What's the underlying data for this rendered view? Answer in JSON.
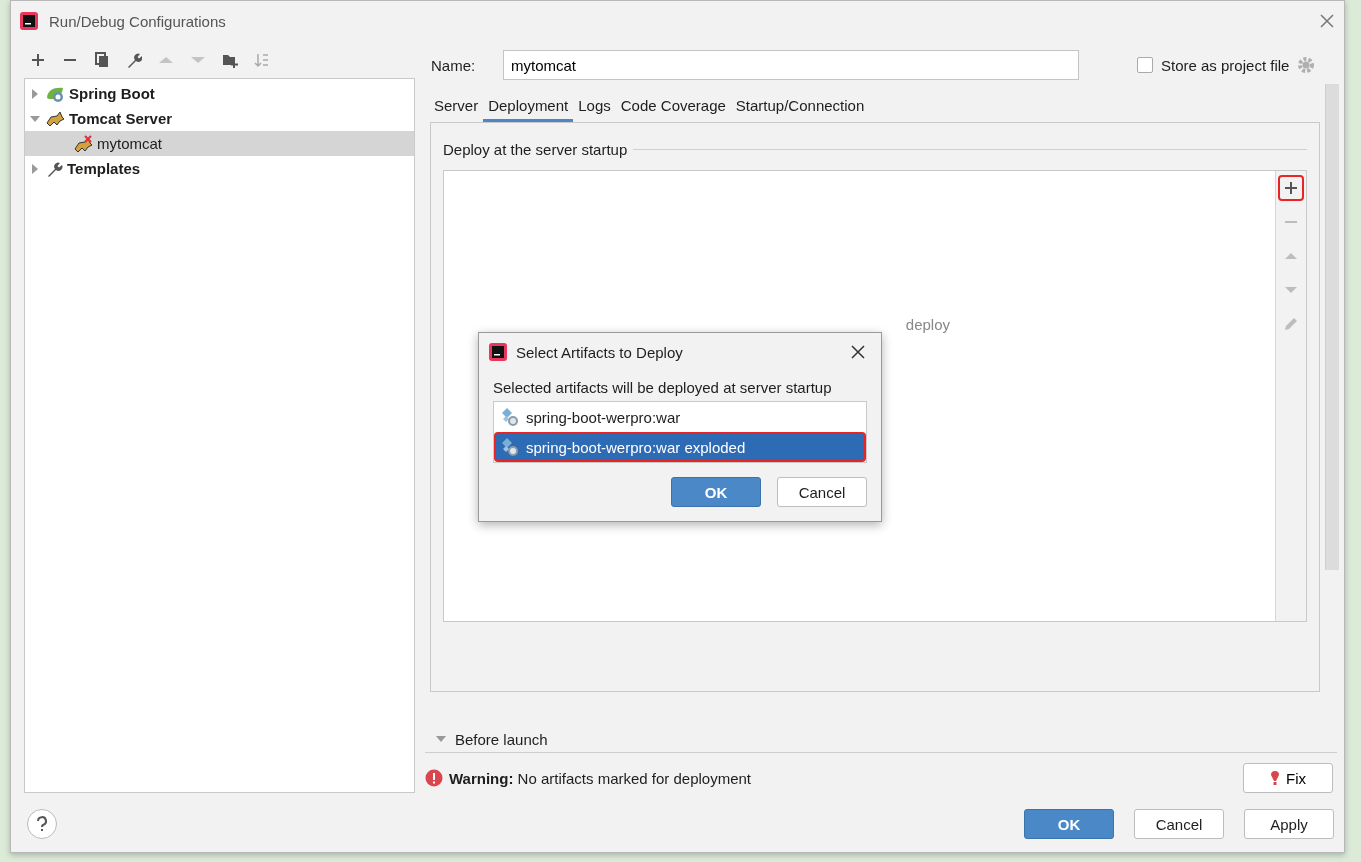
{
  "window": {
    "title": "Run/Debug Configurations"
  },
  "tree": [
    {
      "label": "Spring Boot",
      "kind": "spring",
      "expanded": false,
      "selected": false
    },
    {
      "label": "Tomcat Server",
      "kind": "tomcat",
      "expanded": true,
      "selected": false,
      "children": [
        {
          "label": "mytomcat",
          "kind": "tomcat-error",
          "selected": true
        }
      ]
    },
    {
      "label": "Templates",
      "kind": "wrench",
      "expanded": false,
      "selected": false
    }
  ],
  "name_field": {
    "label": "Name:",
    "value": "mytomcat"
  },
  "store_as_project_file": {
    "label": "Store as project file",
    "checked": false
  },
  "tabs": [
    {
      "label": "Server",
      "selected": false
    },
    {
      "label": "Deployment",
      "selected": true
    },
    {
      "label": "Logs",
      "selected": false
    },
    {
      "label": "Code Coverage",
      "selected": false
    },
    {
      "label": "Startup/Connection",
      "selected": false
    }
  ],
  "deploy_section": {
    "title": "Deploy at the server startup",
    "empty_text": "deploy",
    "side_buttons": [
      {
        "kind": "add",
        "disabled": false,
        "highlighted": true
      },
      {
        "kind": "remove",
        "disabled": true,
        "highlighted": false
      },
      {
        "kind": "up",
        "disabled": true,
        "highlighted": false
      },
      {
        "kind": "down",
        "disabled": true,
        "highlighted": false
      },
      {
        "kind": "edit",
        "disabled": true,
        "highlighted": false
      }
    ]
  },
  "popup": {
    "title": "Select Artifacts to Deploy",
    "description": "Selected artifacts will be deployed at server startup",
    "artifacts": [
      {
        "label": "spring-boot-werpro:war",
        "selected": false,
        "highlighted": false
      },
      {
        "label": "spring-boot-werpro:war exploded",
        "selected": true,
        "highlighted": true
      }
    ],
    "buttons": [
      {
        "label": "OK",
        "kind": "primary"
      },
      {
        "label": "Cancel",
        "kind": "normal"
      }
    ]
  },
  "before_launch": {
    "label": "Before launch",
    "expanded": true
  },
  "warning": {
    "label": "Warning:",
    "message": "No artifacts marked for deployment",
    "fix": "Fix"
  },
  "footer_buttons": [
    {
      "label": "OK",
      "kind": "primary"
    },
    {
      "label": "Cancel",
      "kind": "normal"
    },
    {
      "label": "Apply",
      "kind": "normal"
    }
  ]
}
